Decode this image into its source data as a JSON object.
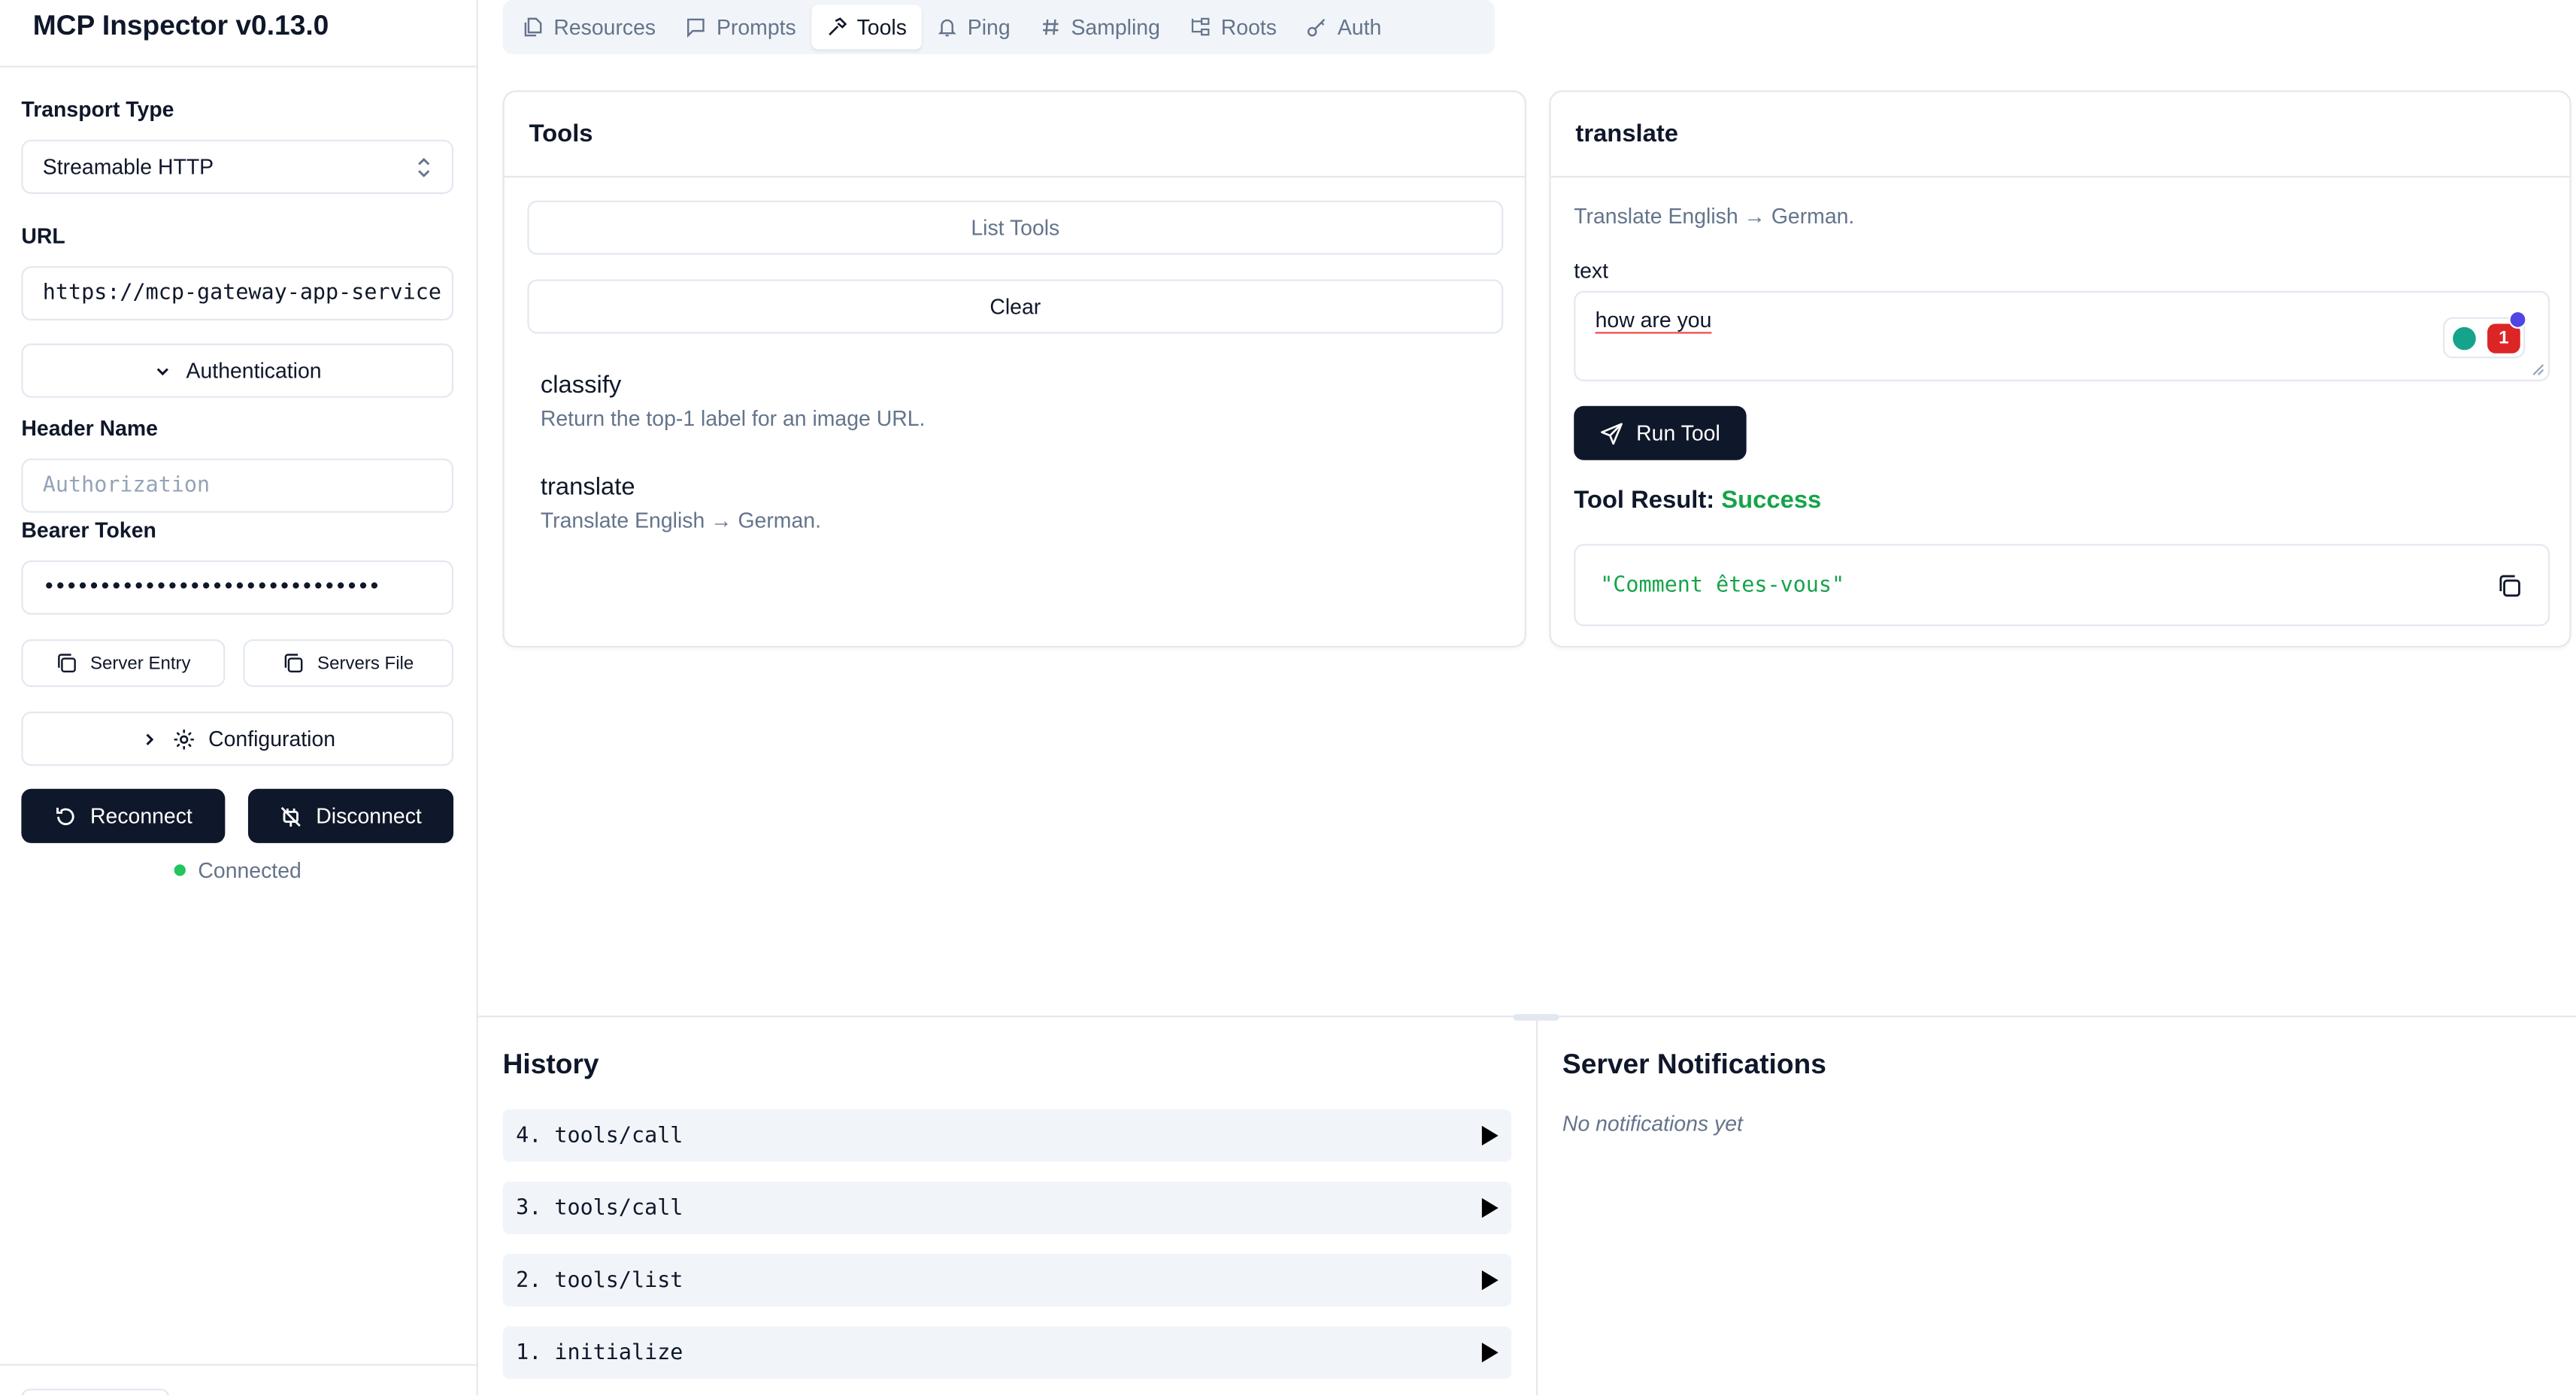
{
  "app": {
    "title": "MCP Inspector v0.13.0"
  },
  "sidebar": {
    "transport_label": "Transport Type",
    "transport_value": "Streamable HTTP",
    "url_label": "URL",
    "url_value": "https://mcp-gateway-app-service",
    "auth_button": "Authentication",
    "header_name_label": "Header Name",
    "header_name_placeholder": "Authorization",
    "bearer_label": "Bearer Token",
    "bearer_value": "••••••••••••••••••••••••••••••",
    "server_entry_button": "Server Entry",
    "servers_file_button": "Servers File",
    "configuration_button": "Configuration",
    "reconnect_button": "Reconnect",
    "disconnect_button": "Disconnect",
    "status_text": "Connected",
    "status_color": "#22c55e"
  },
  "tabs": [
    {
      "label": "Resources",
      "icon": "files-icon"
    },
    {
      "label": "Prompts",
      "icon": "message-square-icon"
    },
    {
      "label": "Tools",
      "icon": "hammer-icon",
      "active": true
    },
    {
      "label": "Ping",
      "icon": "bell-icon"
    },
    {
      "label": "Sampling",
      "icon": "hash-icon"
    },
    {
      "label": "Roots",
      "icon": "folder-tree-icon"
    },
    {
      "label": "Auth",
      "icon": "key-icon"
    }
  ],
  "tools_panel": {
    "title": "Tools",
    "list_button": "List Tools",
    "clear_button": "Clear",
    "items": [
      {
        "name": "classify",
        "description": "Return the top-1 label for an image URL."
      },
      {
        "name": "translate",
        "description": "Translate English → German."
      }
    ]
  },
  "tool_detail": {
    "title": "translate",
    "description": "Translate English → German.",
    "param_label": "text",
    "param_value": "how are you",
    "run_button": "Run Tool",
    "result_label": "Tool Result:",
    "result_status": "Success",
    "result_status_color": "#16a34a",
    "result_value": "\"Comment êtes-vous\"",
    "result_value_color": "#16a34a",
    "extension_badge_count": "1"
  },
  "history": {
    "title": "History",
    "items": [
      "4. tools/call",
      "3. tools/call",
      "2. tools/list",
      "1. initialize"
    ]
  },
  "notifications": {
    "title": "Server Notifications",
    "empty_text": "No notifications yet"
  }
}
